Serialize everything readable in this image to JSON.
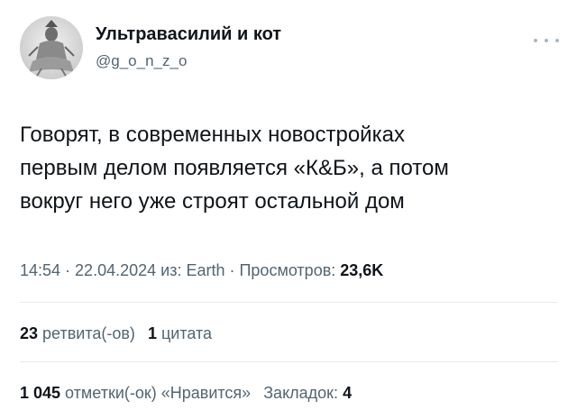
{
  "author": {
    "display_name": "Ультравасилий и кот",
    "handle": "@g_o_n_z_o"
  },
  "tweet": {
    "lines": [
      "Говорят, в современных новостройках",
      "первым делом появляется «К&Б», а потом",
      "вокруг него уже строят остальной дом"
    ]
  },
  "meta": {
    "time": "14:54",
    "sep": " · ",
    "date": "22.04.2024",
    "via_prefix": " из: ",
    "source": "Earth",
    "views_label": "Просмотров: ",
    "views_value": "23,6K"
  },
  "stats": {
    "retweets_count": "23",
    "retweets_label": " ретвита(-ов)",
    "quotes_count": "1",
    "quotes_label": " цитата",
    "likes_count": "1 045",
    "likes_label": " отметки(-ок) «Нравится»",
    "bookmarks_label": "Закладок: ",
    "bookmarks_count": "4"
  },
  "icons": {
    "more": "more-horizontal-icon"
  },
  "colors": {
    "text_primary": "#0f1419",
    "text_secondary": "#536471",
    "divider": "#e6eaed"
  }
}
